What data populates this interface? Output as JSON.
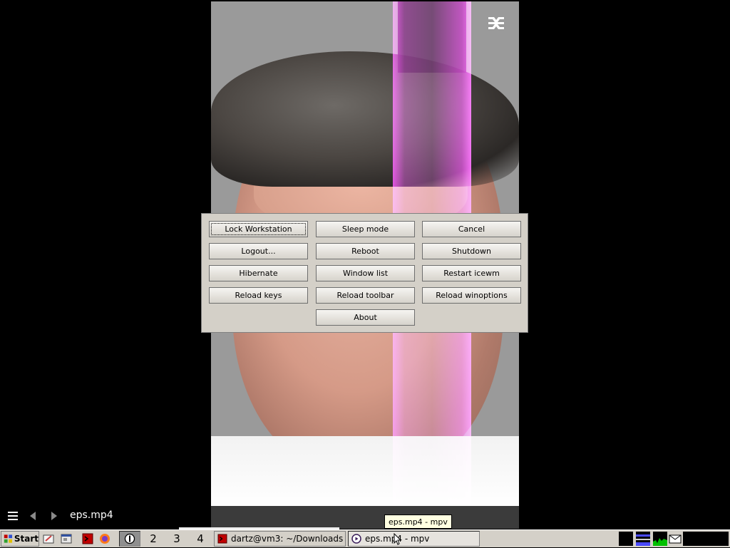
{
  "video": {
    "logo_icon": "capcut-logo-icon"
  },
  "mpv": {
    "filename": "eps.mp4",
    "menu_icon": "hamburger-menu-icon",
    "prev_icon": "previous-track-icon",
    "next_icon": "next-track-icon"
  },
  "dialog": {
    "buttons": [
      "Lock Workstation",
      "Sleep mode",
      "Cancel",
      "Logout...",
      "Reboot",
      "Shutdown",
      "Hibernate",
      "Window list",
      "Restart icewm",
      "Reload keys",
      "Reload toolbar",
      "Reload winoptions",
      "About"
    ]
  },
  "tooltip": "eps.mp4 - mpv",
  "taskbar": {
    "start_label": "Start",
    "workspaces": [
      "1",
      "2",
      "3",
      "4"
    ],
    "tasks": [
      {
        "label": "dartz@vm3: ~/Downloads",
        "icon": "terminal-icon"
      },
      {
        "label": "eps.mp4 - mpv",
        "icon": "mpv-icon"
      }
    ],
    "colors": {
      "panel": "#d4d0c8",
      "terminal_red": "#c00000",
      "net_blue": "#4a4aff",
      "cpu_green": "#00c000"
    }
  }
}
